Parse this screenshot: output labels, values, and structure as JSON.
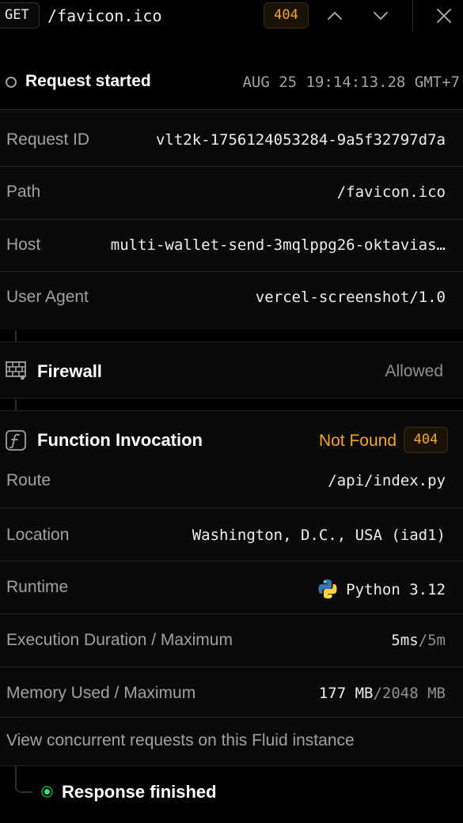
{
  "header": {
    "method": "GET",
    "path": "/favicon.ico",
    "status": "404"
  },
  "request": {
    "title": "Request started",
    "timestamp": "AUG 25 19:14:13.28  GMT+7",
    "rows": [
      {
        "key": "Request ID",
        "value": "vlt2k-1756124053284-9a5f32797d7a"
      },
      {
        "key": "Path",
        "value": "/favicon.ico"
      },
      {
        "key": "Host",
        "value": "multi-wallet-send-3mqlppg26-oktavias…"
      },
      {
        "key": "User Agent",
        "value": "vercel-screenshot/1.0"
      }
    ]
  },
  "firewall": {
    "title": "Firewall",
    "status": "Allowed",
    "icon": "firewall-icon"
  },
  "function": {
    "title": "Function Invocation",
    "status_text": "Not Found",
    "status_code": "404",
    "icon": "function-icon",
    "rows": [
      {
        "key": "Route",
        "value": "/api/index.py"
      },
      {
        "key": "Location",
        "value": "Washington, D.C., USA (iad1)"
      },
      {
        "key": "Runtime",
        "value": "Python 3.12",
        "icon": "python-icon"
      },
      {
        "key": "Execution Duration / Maximum",
        "value": "5ms",
        "max": "/5m"
      },
      {
        "key": "Memory Used / Maximum",
        "value": "177 MB",
        "max": "/2048 MB"
      }
    ],
    "concurrent_link": "View concurrent requests on this Fluid instance"
  },
  "response": {
    "title": "Response finished"
  },
  "colors": {
    "warning": "#f5a623",
    "success": "#3ddc84"
  }
}
